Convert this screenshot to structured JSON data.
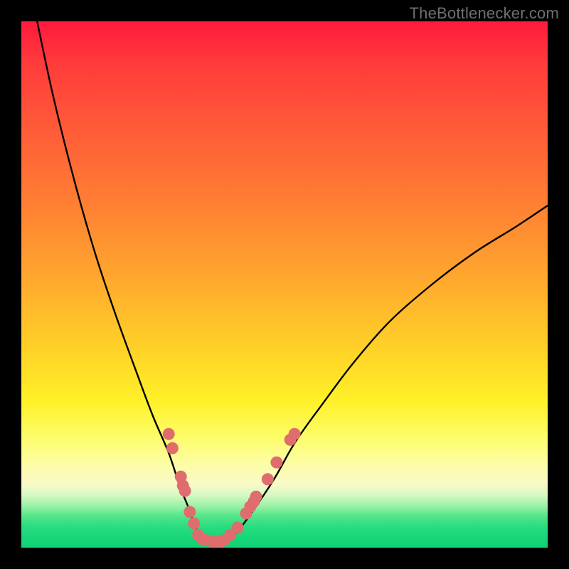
{
  "watermark": "TheBottlenecker.com",
  "colors": {
    "frame_bg": "#000000",
    "curve": "#000000",
    "dot": "#e06d6d",
    "gradient_top": "#ff1a3c",
    "gradient_bottom": "#12d276"
  },
  "chart_data": {
    "type": "line",
    "title": "",
    "xlabel": "",
    "ylabel": "",
    "xlim": [
      0,
      100
    ],
    "ylim": [
      0,
      100
    ],
    "grid": false,
    "legend": false,
    "series": [
      {
        "name": "bottleneck-curve",
        "x": [
          3,
          6,
          10,
          14,
          18,
          22,
          25,
          28,
          30,
          32,
          33,
          34.5,
          36,
          37.5,
          39,
          41,
          44,
          48,
          52,
          57,
          63,
          70,
          78,
          86,
          94,
          100
        ],
        "y": [
          100,
          86,
          70,
          56,
          44,
          33,
          25,
          18,
          12,
          7,
          4,
          2,
          1.2,
          1,
          1.3,
          3,
          7,
          13,
          20,
          27,
          35,
          43,
          50,
          56,
          61,
          65
        ]
      }
    ],
    "markers": [
      {
        "x": 28.0,
        "y": 21.6
      },
      {
        "x": 28.7,
        "y": 18.9
      },
      {
        "x": 30.3,
        "y": 13.5
      },
      {
        "x": 30.7,
        "y": 11.8
      },
      {
        "x": 31.1,
        "y": 10.8
      },
      {
        "x": 32.0,
        "y": 6.8
      },
      {
        "x": 32.8,
        "y": 4.6
      },
      {
        "x": 33.6,
        "y": 2.4
      },
      {
        "x": 34.3,
        "y": 1.7
      },
      {
        "x": 35.1,
        "y": 1.4
      },
      {
        "x": 36.2,
        "y": 1.2
      },
      {
        "x": 37.2,
        "y": 1.1
      },
      {
        "x": 37.8,
        "y": 1.1
      },
      {
        "x": 38.5,
        "y": 1.4
      },
      {
        "x": 39.7,
        "y": 2.4
      },
      {
        "x": 41.1,
        "y": 3.8
      },
      {
        "x": 42.7,
        "y": 6.5
      },
      {
        "x": 43.5,
        "y": 7.8
      },
      {
        "x": 44.2,
        "y": 8.8
      },
      {
        "x": 44.6,
        "y": 9.7
      },
      {
        "x": 46.8,
        "y": 13.0
      },
      {
        "x": 48.5,
        "y": 16.2
      },
      {
        "x": 51.1,
        "y": 20.5
      },
      {
        "x": 51.9,
        "y": 21.6
      }
    ]
  }
}
